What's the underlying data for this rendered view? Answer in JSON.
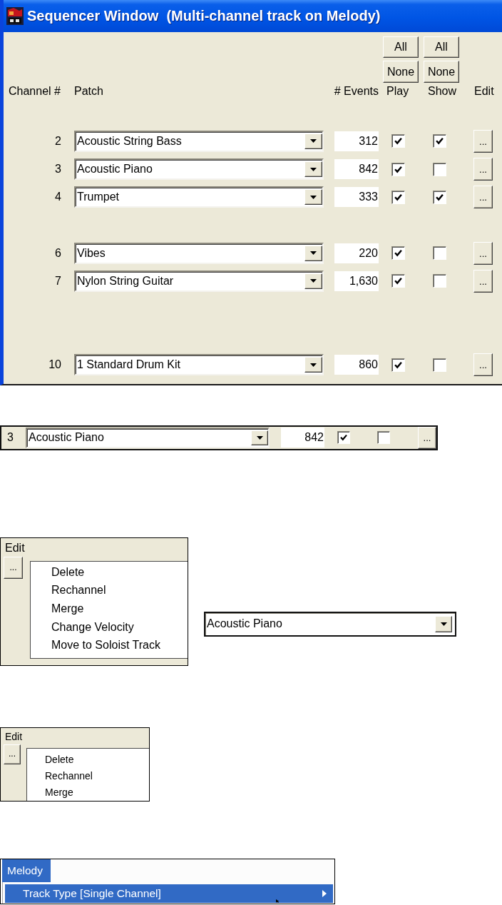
{
  "sequencer_window": {
    "title": "Sequencer Window  (Multi-channel track on Melody)",
    "play_buttons": [
      "All",
      "None"
    ],
    "show_buttons": [
      "All",
      "None"
    ],
    "columns": [
      "Channel #",
      "Patch",
      "# Events",
      "Play",
      "Show",
      "Edit"
    ],
    "rows": [
      {
        "channel": "2",
        "patch": "Acoustic String Bass",
        "events": "312",
        "play": true,
        "show": true,
        "edit": "..."
      },
      {
        "channel": "3",
        "patch": "Acoustic Piano",
        "events": "842",
        "play": true,
        "show": false,
        "edit": "..."
      },
      {
        "channel": "4",
        "patch": "Trumpet",
        "events": "333",
        "play": true,
        "show": true,
        "edit": "..."
      },
      {
        "channel": "6",
        "patch": "Vibes",
        "events": "220",
        "play": true,
        "show": false,
        "edit": "..."
      },
      {
        "channel": "7",
        "patch": "Nylon String Guitar",
        "events": "1,630",
        "play": true,
        "show": false,
        "edit": "..."
      },
      {
        "channel": "10",
        "patch": "1 Standard Drum Kit",
        "events": "860",
        "play": true,
        "show": false,
        "edit": "..."
      }
    ]
  },
  "row_detail": {
    "channel": "3",
    "patch": "Acoustic Piano",
    "events": "842",
    "play": true,
    "show": false,
    "edit": "..."
  },
  "edit_menu_full": {
    "header": "Edit",
    "button": "...",
    "items": [
      "Delete",
      "Rechannel",
      "Merge",
      "Change Velocity",
      "Move to Soloist Track"
    ]
  },
  "patch_combo": {
    "value": "Acoustic Piano"
  },
  "edit_menu_short": {
    "header": "Edit",
    "button": "...",
    "items": [
      "Delete",
      "Rechannel",
      "Merge"
    ]
  },
  "melody_menu": {
    "title": "Melody",
    "selected": true,
    "items": [
      {
        "label": "Track Type [Single Channel]",
        "selected": true,
        "submenu": true
      }
    ]
  }
}
